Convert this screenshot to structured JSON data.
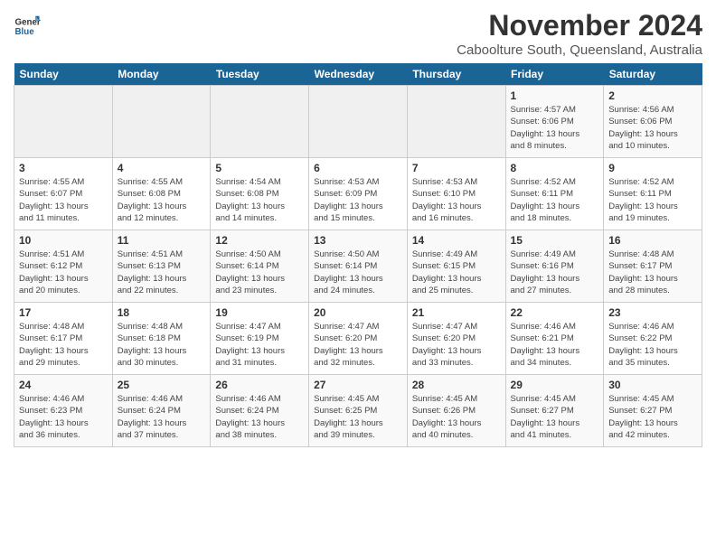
{
  "logo": {
    "line1": "General",
    "line2": "Blue"
  },
  "title": "November 2024",
  "location": "Caboolture South, Queensland, Australia",
  "weekdays": [
    "Sunday",
    "Monday",
    "Tuesday",
    "Wednesday",
    "Thursday",
    "Friday",
    "Saturday"
  ],
  "weeks": [
    [
      {
        "day": "",
        "info": ""
      },
      {
        "day": "",
        "info": ""
      },
      {
        "day": "",
        "info": ""
      },
      {
        "day": "",
        "info": ""
      },
      {
        "day": "",
        "info": ""
      },
      {
        "day": "1",
        "info": "Sunrise: 4:57 AM\nSunset: 6:06 PM\nDaylight: 13 hours\nand 8 minutes."
      },
      {
        "day": "2",
        "info": "Sunrise: 4:56 AM\nSunset: 6:06 PM\nDaylight: 13 hours\nand 10 minutes."
      }
    ],
    [
      {
        "day": "3",
        "info": "Sunrise: 4:55 AM\nSunset: 6:07 PM\nDaylight: 13 hours\nand 11 minutes."
      },
      {
        "day": "4",
        "info": "Sunrise: 4:55 AM\nSunset: 6:08 PM\nDaylight: 13 hours\nand 12 minutes."
      },
      {
        "day": "5",
        "info": "Sunrise: 4:54 AM\nSunset: 6:08 PM\nDaylight: 13 hours\nand 14 minutes."
      },
      {
        "day": "6",
        "info": "Sunrise: 4:53 AM\nSunset: 6:09 PM\nDaylight: 13 hours\nand 15 minutes."
      },
      {
        "day": "7",
        "info": "Sunrise: 4:53 AM\nSunset: 6:10 PM\nDaylight: 13 hours\nand 16 minutes."
      },
      {
        "day": "8",
        "info": "Sunrise: 4:52 AM\nSunset: 6:11 PM\nDaylight: 13 hours\nand 18 minutes."
      },
      {
        "day": "9",
        "info": "Sunrise: 4:52 AM\nSunset: 6:11 PM\nDaylight: 13 hours\nand 19 minutes."
      }
    ],
    [
      {
        "day": "10",
        "info": "Sunrise: 4:51 AM\nSunset: 6:12 PM\nDaylight: 13 hours\nand 20 minutes."
      },
      {
        "day": "11",
        "info": "Sunrise: 4:51 AM\nSunset: 6:13 PM\nDaylight: 13 hours\nand 22 minutes."
      },
      {
        "day": "12",
        "info": "Sunrise: 4:50 AM\nSunset: 6:14 PM\nDaylight: 13 hours\nand 23 minutes."
      },
      {
        "day": "13",
        "info": "Sunrise: 4:50 AM\nSunset: 6:14 PM\nDaylight: 13 hours\nand 24 minutes."
      },
      {
        "day": "14",
        "info": "Sunrise: 4:49 AM\nSunset: 6:15 PM\nDaylight: 13 hours\nand 25 minutes."
      },
      {
        "day": "15",
        "info": "Sunrise: 4:49 AM\nSunset: 6:16 PM\nDaylight: 13 hours\nand 27 minutes."
      },
      {
        "day": "16",
        "info": "Sunrise: 4:48 AM\nSunset: 6:17 PM\nDaylight: 13 hours\nand 28 minutes."
      }
    ],
    [
      {
        "day": "17",
        "info": "Sunrise: 4:48 AM\nSunset: 6:17 PM\nDaylight: 13 hours\nand 29 minutes."
      },
      {
        "day": "18",
        "info": "Sunrise: 4:48 AM\nSunset: 6:18 PM\nDaylight: 13 hours\nand 30 minutes."
      },
      {
        "day": "19",
        "info": "Sunrise: 4:47 AM\nSunset: 6:19 PM\nDaylight: 13 hours\nand 31 minutes."
      },
      {
        "day": "20",
        "info": "Sunrise: 4:47 AM\nSunset: 6:20 PM\nDaylight: 13 hours\nand 32 minutes."
      },
      {
        "day": "21",
        "info": "Sunrise: 4:47 AM\nSunset: 6:20 PM\nDaylight: 13 hours\nand 33 minutes."
      },
      {
        "day": "22",
        "info": "Sunrise: 4:46 AM\nSunset: 6:21 PM\nDaylight: 13 hours\nand 34 minutes."
      },
      {
        "day": "23",
        "info": "Sunrise: 4:46 AM\nSunset: 6:22 PM\nDaylight: 13 hours\nand 35 minutes."
      }
    ],
    [
      {
        "day": "24",
        "info": "Sunrise: 4:46 AM\nSunset: 6:23 PM\nDaylight: 13 hours\nand 36 minutes."
      },
      {
        "day": "25",
        "info": "Sunrise: 4:46 AM\nSunset: 6:24 PM\nDaylight: 13 hours\nand 37 minutes."
      },
      {
        "day": "26",
        "info": "Sunrise: 4:46 AM\nSunset: 6:24 PM\nDaylight: 13 hours\nand 38 minutes."
      },
      {
        "day": "27",
        "info": "Sunrise: 4:45 AM\nSunset: 6:25 PM\nDaylight: 13 hours\nand 39 minutes."
      },
      {
        "day": "28",
        "info": "Sunrise: 4:45 AM\nSunset: 6:26 PM\nDaylight: 13 hours\nand 40 minutes."
      },
      {
        "day": "29",
        "info": "Sunrise: 4:45 AM\nSunset: 6:27 PM\nDaylight: 13 hours\nand 41 minutes."
      },
      {
        "day": "30",
        "info": "Sunrise: 4:45 AM\nSunset: 6:27 PM\nDaylight: 13 hours\nand 42 minutes."
      }
    ]
  ]
}
